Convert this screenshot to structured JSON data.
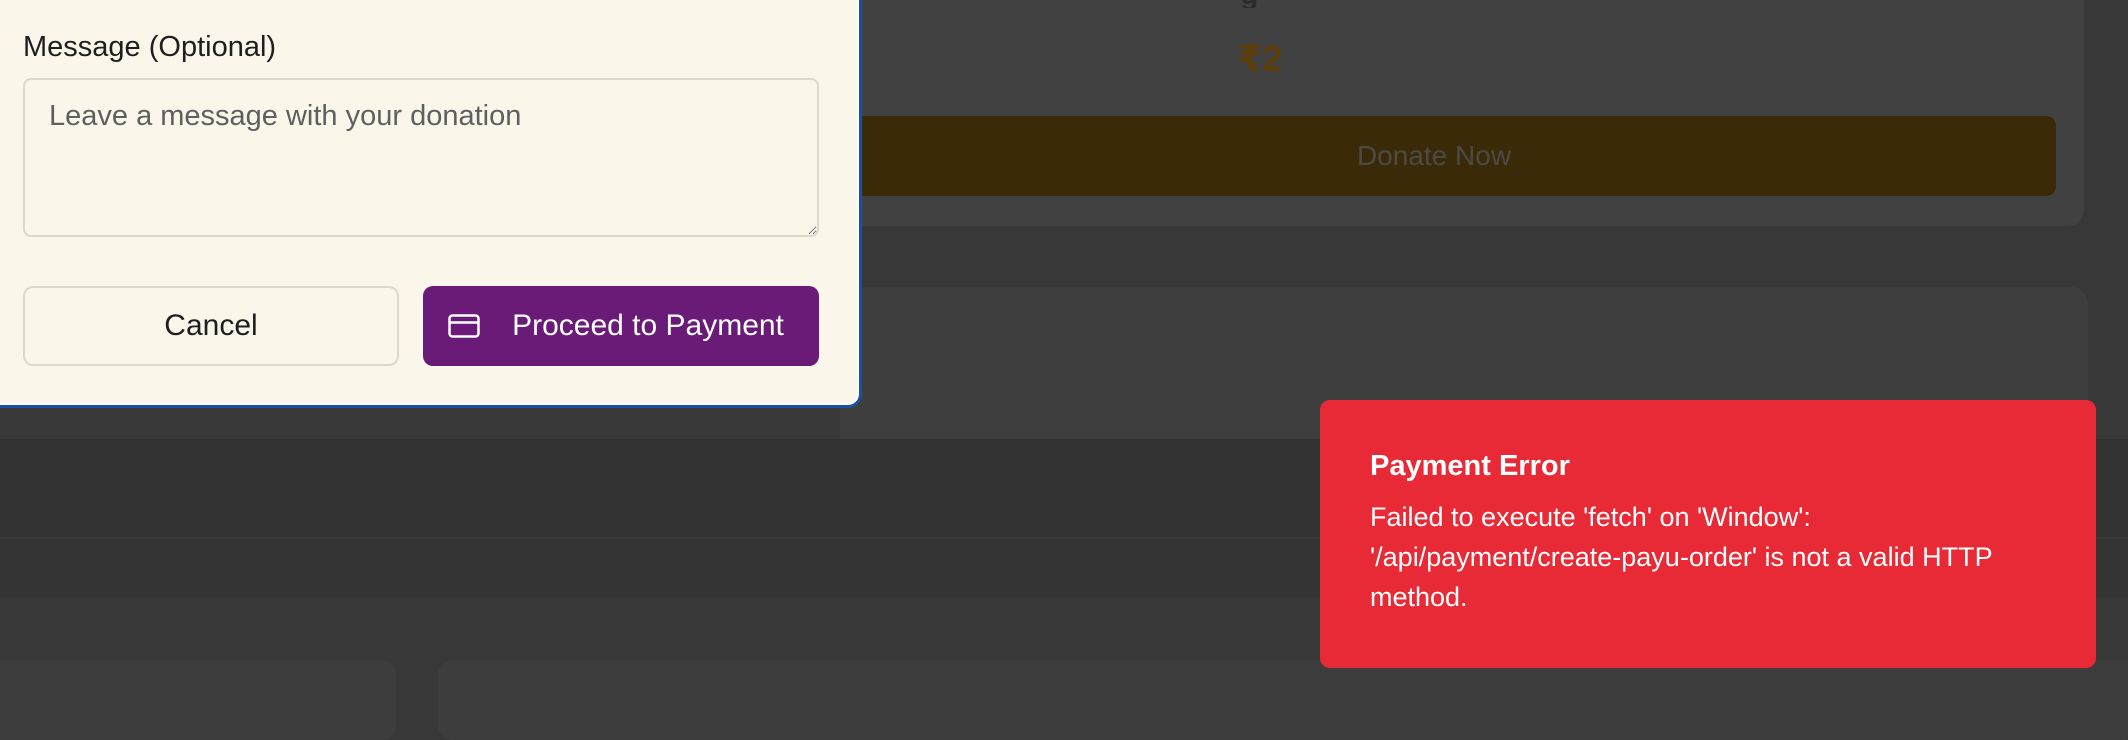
{
  "background": {
    "amount": "₹2",
    "donate_button": "Donate Now"
  },
  "modal": {
    "message_label": "Message (Optional)",
    "message_placeholder": "Leave a message with your donation",
    "message_value": "",
    "cancel_label": "Cancel",
    "proceed_label": "Proceed to Payment",
    "proceed_icon": "credit-card-icon"
  },
  "toast": {
    "title": "Payment Error",
    "message": "Failed to execute 'fetch' on 'Window': '/api/payment/create-payu-order' is not a valid HTTP method."
  },
  "colors": {
    "overlay_bg": "#383838",
    "modal_bg": "#faf6ea",
    "modal_border": "#1d4fa1",
    "primary": "#6a1b78",
    "error": "#e82a36",
    "amount_dim": "#5e3e08"
  }
}
